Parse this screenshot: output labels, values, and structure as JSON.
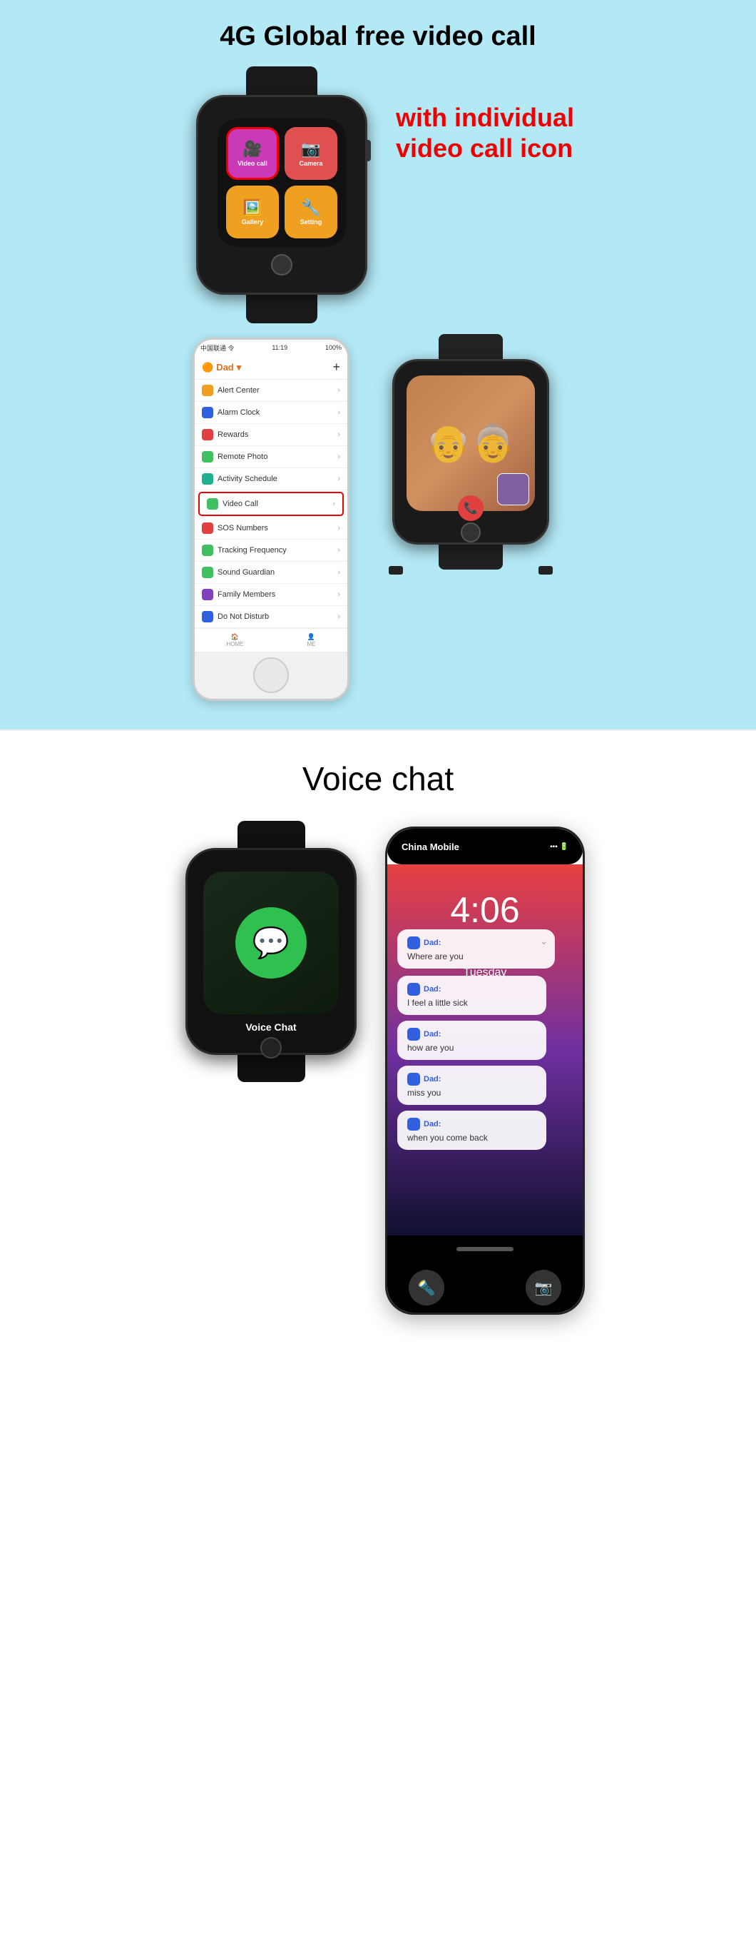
{
  "page": {
    "top_section": {
      "title": "4G Global free video call",
      "tagline_line1": "with individual",
      "tagline_line2": "video call icon",
      "watch1": {
        "buttons": [
          {
            "label": "Video call",
            "color": "purple",
            "icon": "🎥",
            "highlighted": true
          },
          {
            "label": "Camera",
            "color": "red",
            "icon": "📷",
            "highlighted": false
          },
          {
            "label": "Gallery",
            "color": "orange",
            "icon": "🖼️",
            "highlighted": false
          },
          {
            "label": "Setting",
            "color": "orange",
            "icon": "🔧",
            "highlighted": false
          }
        ]
      },
      "phone": {
        "status_bar": {
          "network": "中国联通 令",
          "time": "11:19",
          "battery": "100%"
        },
        "header": {
          "icon": "🟠",
          "title": "Dad",
          "dropdown": "▾",
          "add": "+"
        },
        "menu_items": [
          {
            "icon_color": "orange",
            "label": "Alert Center",
            "highlighted": false
          },
          {
            "icon_color": "blue",
            "label": "Alarm Clock",
            "highlighted": false
          },
          {
            "icon_color": "red",
            "label": "Rewards",
            "highlighted": false
          },
          {
            "icon_color": "green",
            "label": "Remote Photo",
            "highlighted": false
          },
          {
            "icon_color": "teal",
            "label": "Activity Schedule",
            "highlighted": false
          },
          {
            "icon_color": "green",
            "label": "Video Call",
            "highlighted": true
          },
          {
            "icon_color": "red",
            "label": "SOS Numbers",
            "highlighted": false
          },
          {
            "icon_color": "green",
            "label": "Tracking Frequency",
            "highlighted": false
          },
          {
            "icon_color": "green",
            "label": "Sound Guardian",
            "highlighted": false
          },
          {
            "icon_color": "purple",
            "label": "Family Members",
            "highlighted": false
          },
          {
            "icon_color": "blue",
            "label": "Do Not Disturb",
            "highlighted": false
          }
        ],
        "bottom_nav": [
          {
            "label": "HOME",
            "icon": "🏠"
          },
          {
            "label": "ME",
            "icon": "👤"
          }
        ]
      },
      "watch2": {
        "video_call": {
          "couple_emoji": "👴👵",
          "call_button": "📞"
        }
      }
    },
    "bottom_section": {
      "title": "Voice chat",
      "voice_watch": {
        "label": "Voice Chat",
        "icon": "💬"
      },
      "iphone": {
        "carrier": "China Mobile",
        "time": "4:06",
        "date": "Tuesday",
        "chat_bubbles": [
          {
            "sender": "Dad:",
            "message": "Where are you",
            "expand": true
          },
          {
            "sender": "Dad:",
            "message": "I feel a little sick"
          },
          {
            "sender": "Dad:",
            "message": "how are you"
          },
          {
            "sender": "Dad:",
            "message": "miss you"
          },
          {
            "sender": "Dad:",
            "message": "when you come back"
          }
        ]
      }
    }
  }
}
